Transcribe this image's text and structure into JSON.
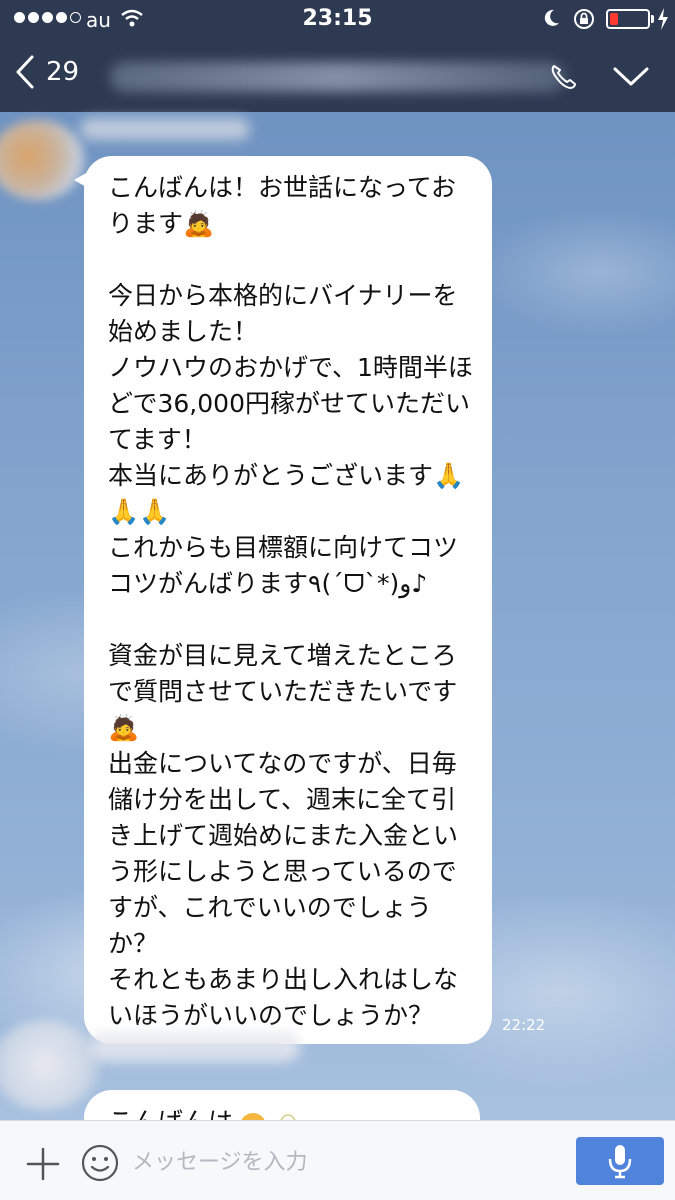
{
  "status_bar": {
    "carrier": "au",
    "time": "23:15"
  },
  "header": {
    "unread_count": "29"
  },
  "messages": [
    {
      "text": "こんばんは！お世話になっております🙇\n\n今日から本格的にバイナリーを始めました！\nノウハウのおかげで、1時間半ほどで36,000円稼がせていただいてます！\n本当にありがとうございます🙏🙏🙏\nこれからも目標額に向けてコツコツがんばります٩(´ᗜ`*)و♪\n\n資金が目に見えて増えたところで質問させていただきたいです🙇\n出金についてなのですが、日毎儲け分を出して、週末に全て引き上げて週始めにまた入金という形にしようと思っているのですが、これでいいのでしょうか？\nそれともあまり出し入れはしないほうがいいのでしょうか？",
      "time": "22:22"
    },
    {
      "text": "こんばんは"
    }
  ],
  "input_bar": {
    "placeholder": "メッセージを入力"
  },
  "colors": {
    "header_bg": "#2e3a52",
    "battery_low": "#ff3b30",
    "mic_button": "#4f83dc",
    "bubble": "#ffffff"
  },
  "icons": {
    "back": "chevron-left-icon",
    "call": "phone-icon",
    "dropdown": "chevron-down-icon",
    "add": "plus-icon",
    "emoji": "smiley-icon",
    "mic": "microphone-icon"
  }
}
